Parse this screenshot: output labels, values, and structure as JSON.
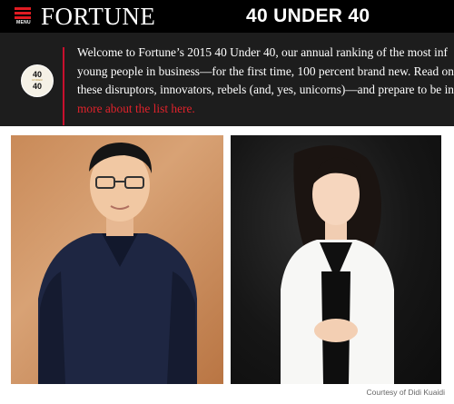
{
  "header": {
    "menu_label": "MENU",
    "logo_text": "FORTUNE",
    "page_title": "40 UNDER 40",
    "accent_color": "#e11b22"
  },
  "intro": {
    "badge": {
      "top": "40",
      "middle": "UNDER",
      "bottom": "40"
    },
    "lines": [
      "Welcome to Fortune’s 2015 40 Under 40, our annual ranking of the most inf",
      "young people in business—for the first time, 100 percent brand new. Read on",
      "these disruptors, innovators, rebels (and, yes, unicorns)—and prepare to be in"
    ],
    "link_text": "more about the list here.",
    "link_color": "#e0222b"
  },
  "photos": {
    "left_alt": "Man in navy polo shirt",
    "right_alt": "Woman in white jacket"
  },
  "credit": "Courtesy of Didi Kuaidi"
}
